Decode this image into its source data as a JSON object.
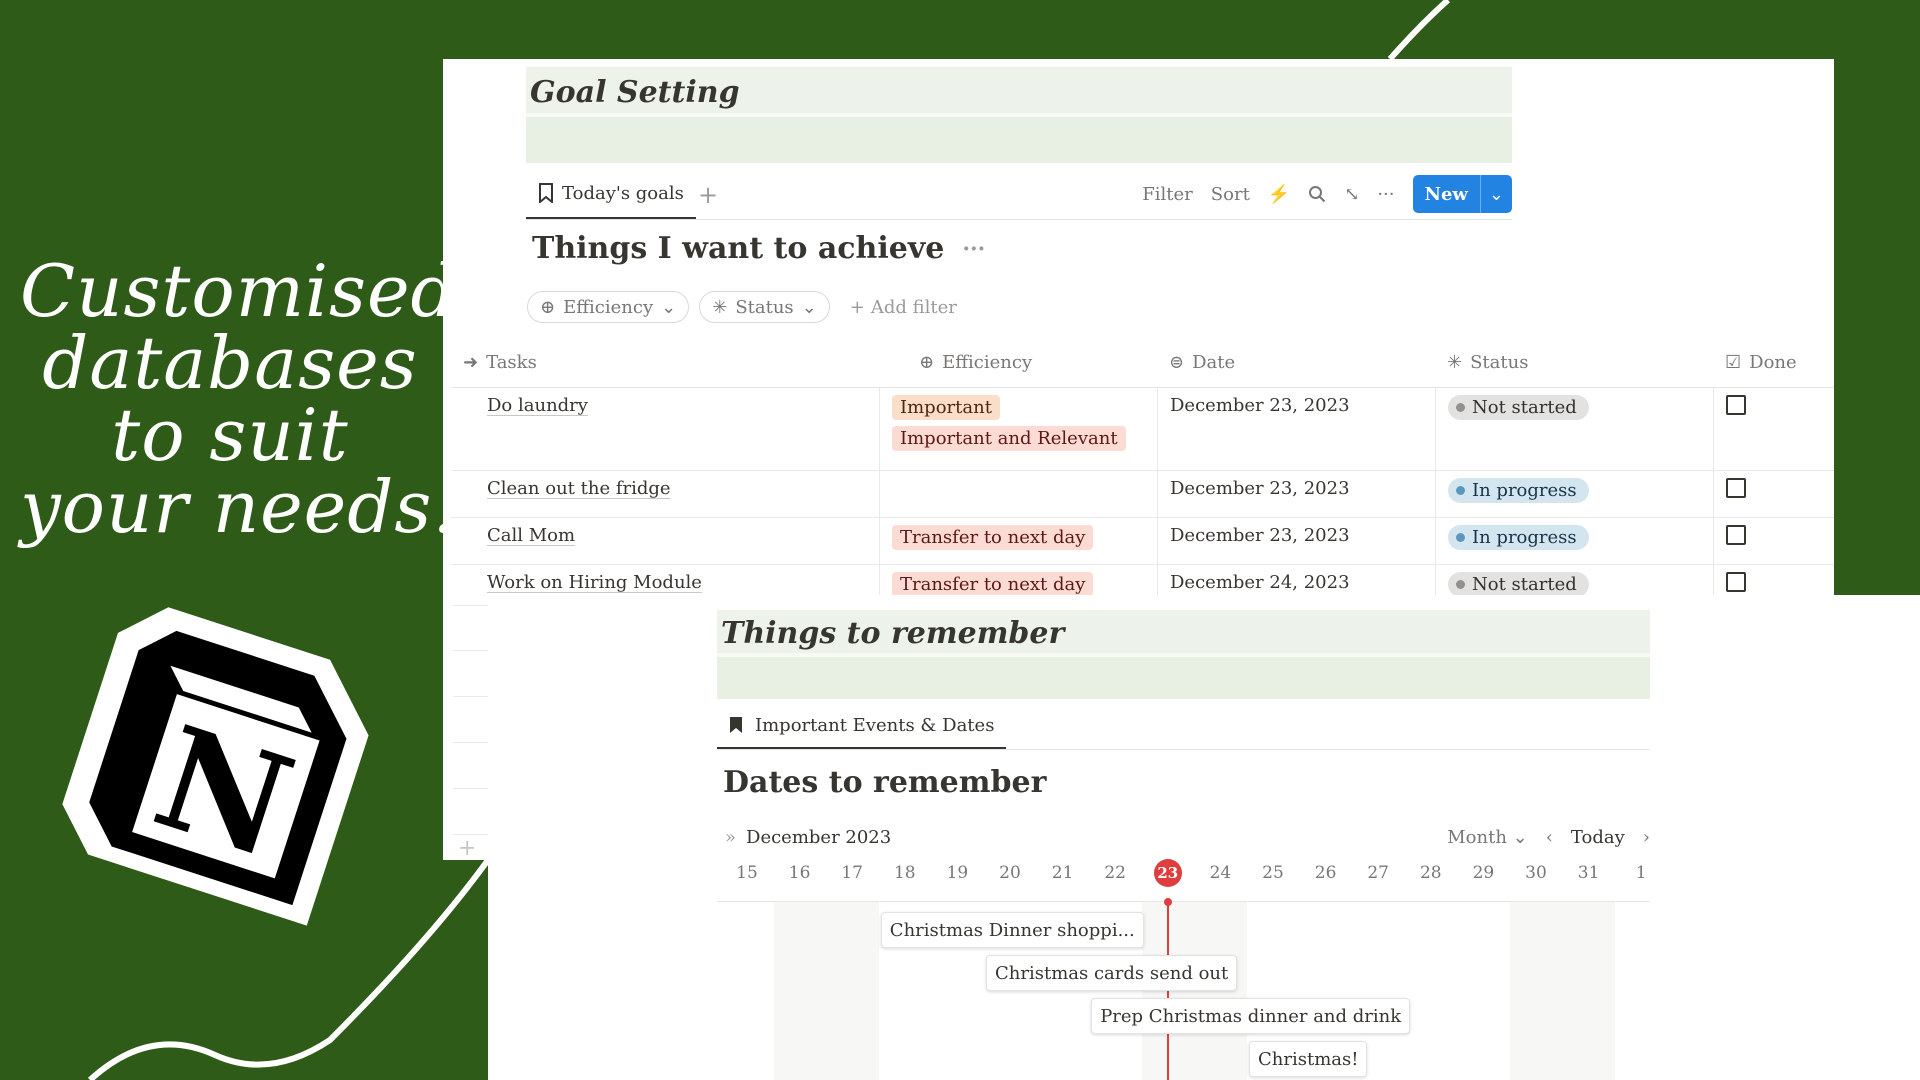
{
  "headline": [
    "Customised",
    "databases",
    "to suit",
    "your needs."
  ],
  "goal_page": {
    "title": "Goal Setting",
    "tab_label": "Today's goals",
    "toolbar": {
      "filter": "Filter",
      "sort": "Sort",
      "new": "New"
    },
    "database_title": "Things I want to achieve",
    "filters": {
      "efficiency": "Efficiency",
      "status": "Status",
      "add_filter": "Add filter"
    },
    "columns": {
      "tasks": "Tasks",
      "efficiency": "Efficiency",
      "date": "Date",
      "status": "Status",
      "done": "Done"
    },
    "rows": [
      {
        "task": "Do laundry",
        "efficiency": [
          "Important",
          "Important and Relevant"
        ],
        "date": "December 23, 2023",
        "status": "Not started",
        "done": false
      },
      {
        "task": "Clean out the fridge",
        "efficiency": [],
        "date": "December 23, 2023",
        "status": "In progress",
        "done": false
      },
      {
        "task": "Call Mom",
        "efficiency": [
          "Transfer to next day"
        ],
        "date": "December 23, 2023",
        "status": "In progress",
        "done": false
      },
      {
        "task": "Work on Hiring Module",
        "efficiency": [
          "Transfer to next day"
        ],
        "date": "December 24, 2023",
        "status": "Not started",
        "done": false
      }
    ]
  },
  "remember_page": {
    "title": "Things to remember",
    "tab_label": "Important Events & Dates",
    "database_title": "Dates to remember",
    "calendar": {
      "month_label": "December 2023",
      "view": "Month",
      "today_label": "Today",
      "days": [
        "15",
        "16",
        "17",
        "18",
        "19",
        "20",
        "21",
        "22",
        "23",
        "24",
        "25",
        "26",
        "27",
        "28",
        "29",
        "30",
        "31",
        "1"
      ],
      "current_day": "23",
      "events": [
        {
          "label": "Christmas Dinner shoppi...",
          "start": "18"
        },
        {
          "label": "Christmas cards send out",
          "start": "20"
        },
        {
          "label": "Prep Christmas dinner and drink",
          "start": "22"
        },
        {
          "label": "Christmas!",
          "start": "25"
        }
      ]
    }
  },
  "colors": {
    "background": "#2e5b17",
    "title_band": "#e8efe3",
    "accent_blue": "#2383e2",
    "today_red": "#e03e3e"
  }
}
